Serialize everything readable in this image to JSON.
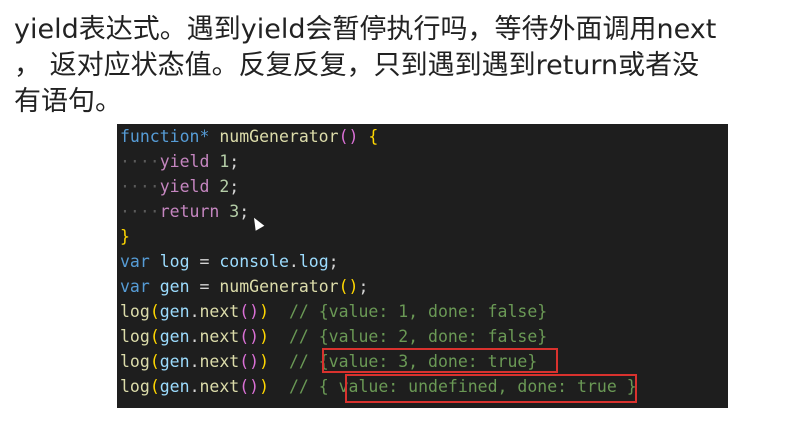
{
  "heading": {
    "line1": "yield表达式。遇到yield会暂停执行吗，等待外面调用next",
    "line2": "， 返对应状态值。反复反复，只到遇到遇到return或者没",
    "line3": "有语句。"
  },
  "code": {
    "l1": {
      "kw": "function*",
      "fn": "numGenerator",
      "parens": "()",
      "brace": "{"
    },
    "l2": {
      "indent": "····",
      "kw": "yield",
      "num": "1",
      "semi": ";"
    },
    "l3": {
      "indent": "····",
      "kw": "yield",
      "num": "2",
      "semi": ";"
    },
    "l4": {
      "indent": "····",
      "kw": "return",
      "num": "3",
      "semi": ";"
    },
    "l5": {
      "brace": "}"
    },
    "l6": {
      "kw": "var",
      "name": "log",
      "eq": "=",
      "obj": "console",
      "dot": ".",
      "prop": "log",
      "semi": ";"
    },
    "l7": {
      "kw": "var",
      "name": "gen",
      "eq": "=",
      "fn": "numGenerator",
      "parens": "()",
      "semi": ";"
    },
    "calls": [
      {
        "fn": "log",
        "open": "(",
        "obj": "gen",
        "dot": ".",
        "method": "next",
        "inner": "()",
        "close": ")",
        "comment": "// {value: 1, done: false}"
      },
      {
        "fn": "log",
        "open": "(",
        "obj": "gen",
        "dot": ".",
        "method": "next",
        "inner": "()",
        "close": ")",
        "comment": "// {value: 2, done: false}"
      },
      {
        "fn": "log",
        "open": "(",
        "obj": "gen",
        "dot": ".",
        "method": "next",
        "inner": "()",
        "close": ")",
        "comment": "// {value: 3, done: true}"
      },
      {
        "fn": "log",
        "open": "(",
        "obj": "gen",
        "dot": ".",
        "method": "next",
        "inner": "()",
        "close": ")",
        "comment": "// { value: undefined, done: true }"
      }
    ]
  },
  "colors": {
    "editor_bg": "#1e1e1e",
    "keyword": "#569cd6",
    "function": "#dcdcaa",
    "variable": "#9cdcfe",
    "number": "#b5cea8",
    "comment": "#6a9955",
    "highlight_border": "#d9322e"
  },
  "icons": {
    "cursor": "mouse-pointer-icon"
  }
}
